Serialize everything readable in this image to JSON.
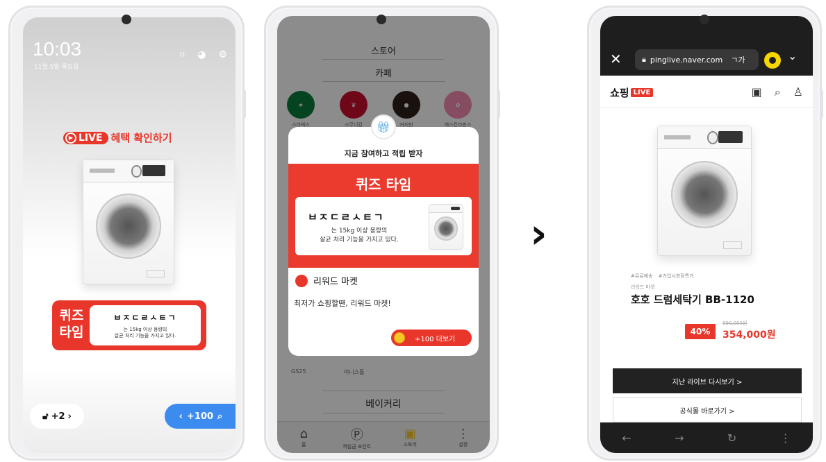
{
  "phone1": {
    "clock": "10:03",
    "clock_sub": "11월 5일 목요일",
    "live_label": "LIVE",
    "live_cta": "혜택 확인하기",
    "quiz_word": "퀴즈 타임",
    "quiz_code": "ㅂㅈㄷㄹㅅㅌㄱ",
    "quiz_desc_1": "는 15kg 이상 용량의",
    "quiz_desc_2": "살균 처리 기능을 가지고 있다.",
    "lock_count": "+2",
    "points_label": "+100"
  },
  "phone2": {
    "store_title": "스토어",
    "cafe_title": "카페",
    "logos": [
      "스타벅스",
      "스무디킹",
      "커피빈",
      "베스킨라빈스"
    ],
    "gs_label": "GS25",
    "mini_label": "미니스톱",
    "bakery_title": "베이커리",
    "tabs": [
      "홈",
      "적립금 포인트",
      "스토어",
      "설정"
    ],
    "modal": {
      "header": "지금 참여하고 적립 받자",
      "quiz_time": "퀴즈 타임",
      "quiz_code": "ㅂㅈㄷㄹㅅㅌㄱ",
      "quiz_desc_1": "는 15kg 이상 용량의",
      "quiz_desc_2": "살균 처리 기능을 가지고 있다.",
      "brand": "리워드 마켓",
      "message": "최저가 쇼핑할땐, 리워드 마켓!",
      "more_button": "+100 더보기"
    }
  },
  "phone3": {
    "url": "pinglive.naver.com",
    "shop_logo": "쇼핑",
    "shop_live": "LIVE",
    "tags": [
      "#무료배송",
      "#가입시한정특가"
    ],
    "brand_small": "리워드 마켓",
    "product_name": "호호 드럼세탁기 BB-1120",
    "discount": "40%",
    "original_price": "590,000원",
    "sale_price": "354,000원",
    "replay_button": "지난 라이브 다시보기 >",
    "official_button": "공식몰 바로가기 >"
  },
  "colors": {
    "brand_red": "#e8362a",
    "blue": "#3c8cf0",
    "dark": "#1e1e1e"
  }
}
